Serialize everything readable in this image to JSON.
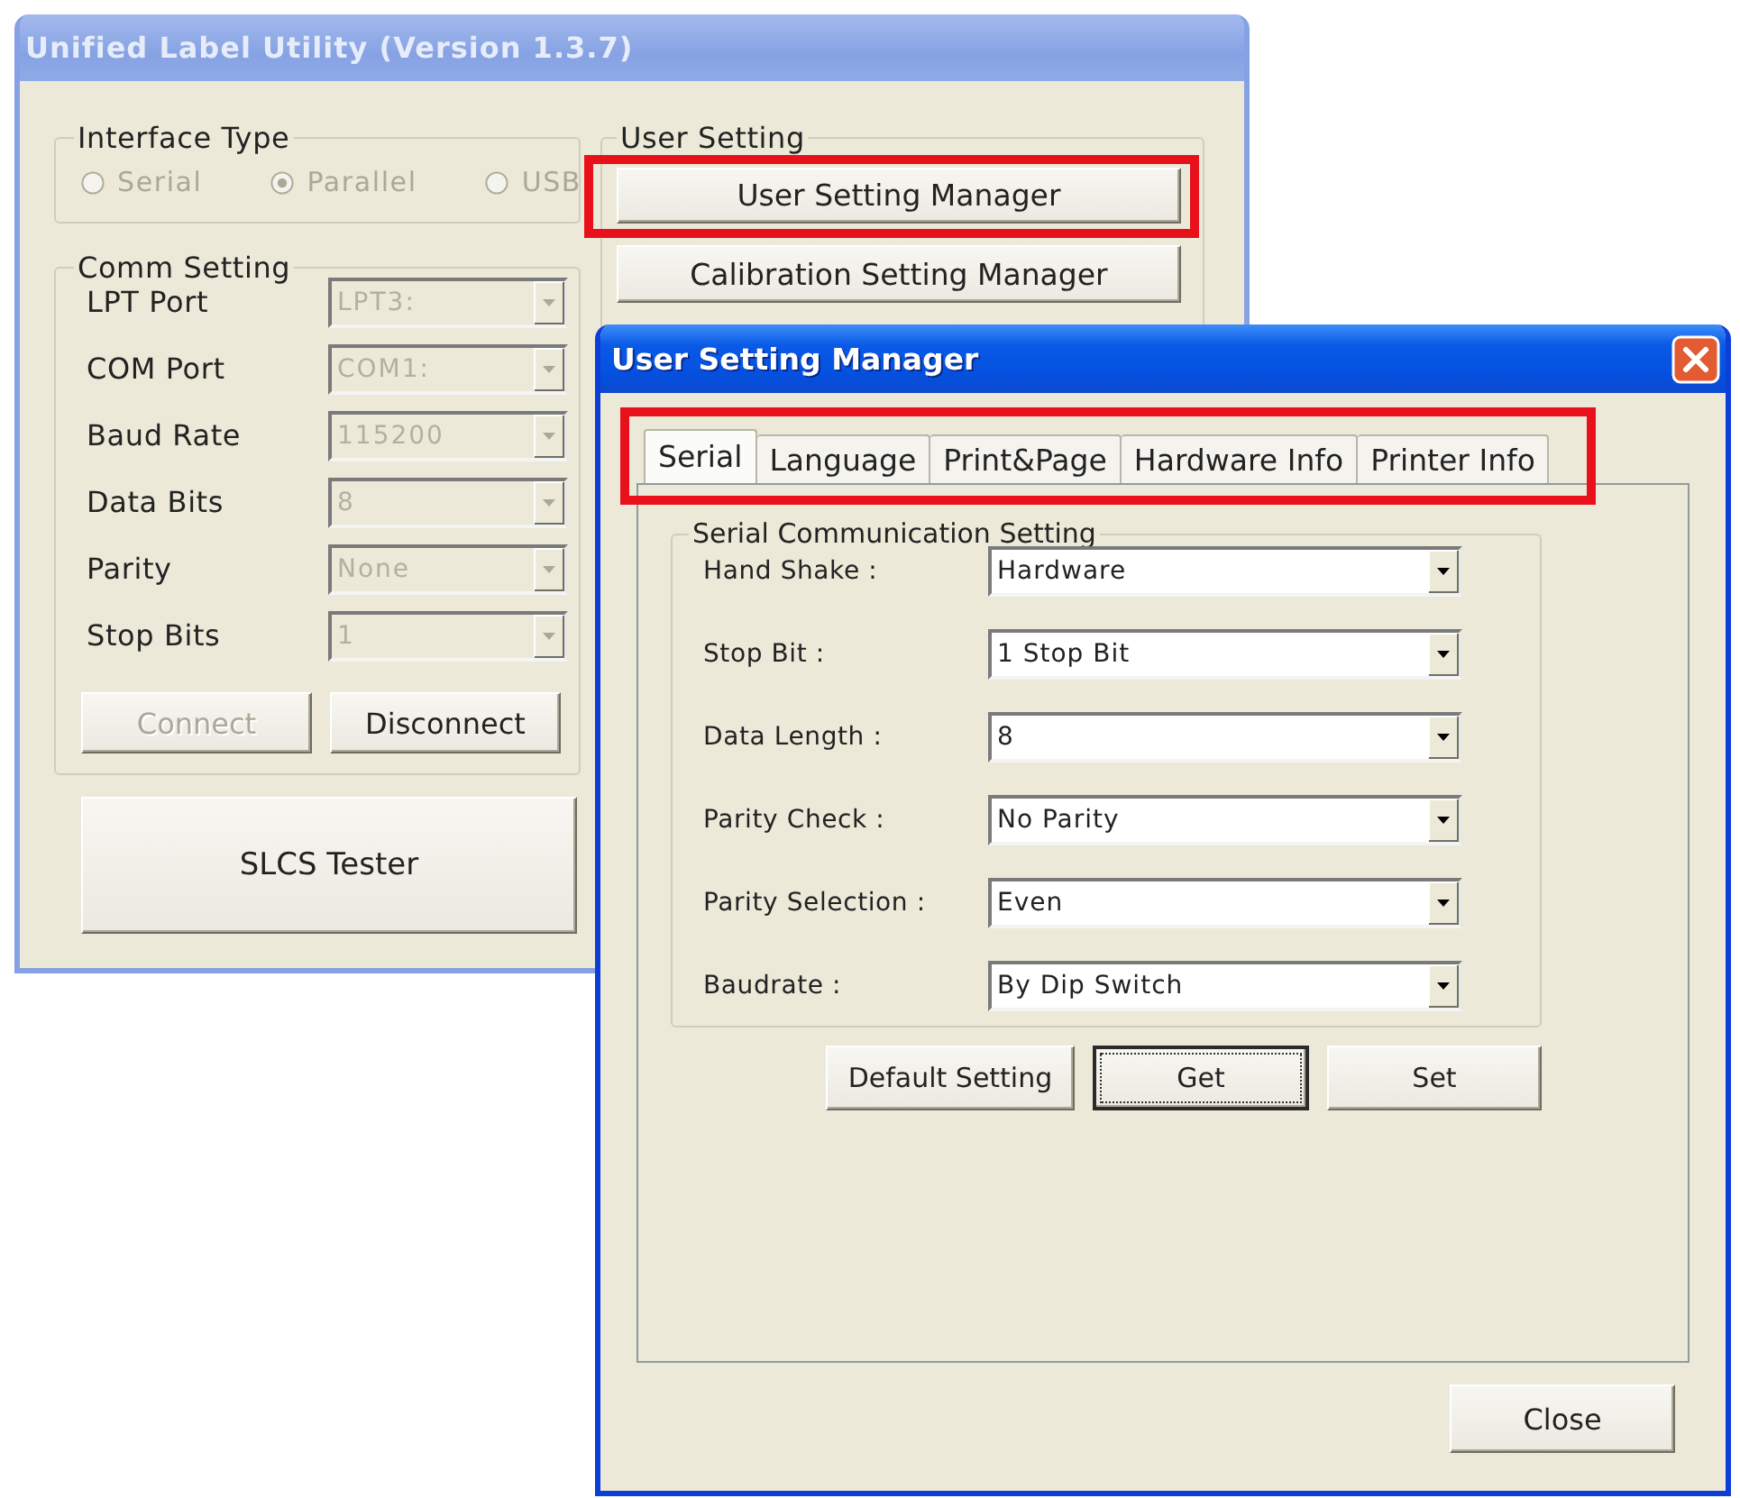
{
  "main_window": {
    "title": "Unified Label Utility (Version 1.3.7)",
    "active": false,
    "interface_type": {
      "legend": "Interface Type",
      "options": [
        {
          "label": "Serial",
          "selected": false,
          "disabled": true
        },
        {
          "label": "Parallel",
          "selected": true,
          "disabled": true
        },
        {
          "label": "USB",
          "selected": false,
          "disabled": true
        }
      ]
    },
    "comm_setting": {
      "legend": "Comm Setting",
      "fields": [
        {
          "label": "LPT Port",
          "value": "LPT3:",
          "disabled": true
        },
        {
          "label": "COM Port",
          "value": "COM1:",
          "disabled": true
        },
        {
          "label": "Baud Rate",
          "value": "115200",
          "disabled": true
        },
        {
          "label": "Data Bits",
          "value": "8",
          "disabled": true
        },
        {
          "label": "Parity",
          "value": "None",
          "disabled": true
        },
        {
          "label": "Stop Bits",
          "value": "1",
          "disabled": true
        }
      ],
      "buttons": [
        {
          "label": "Connect",
          "disabled": true
        },
        {
          "label": "Disconnect",
          "disabled": false
        }
      ]
    },
    "tester_button": {
      "label": "SLCS Tester"
    },
    "user_setting": {
      "legend": "User Setting",
      "buttons": [
        {
          "label": "User Setting Manager",
          "highlighted": true
        },
        {
          "label": "Calibration Setting Manager",
          "highlighted": false
        }
      ]
    }
  },
  "dialog": {
    "title": "User Setting Manager",
    "active": true,
    "tabs_highlighted": true,
    "tabs": [
      {
        "label": "Serial",
        "selected": true
      },
      {
        "label": "Language",
        "selected": false
      },
      {
        "label": "Print&Page",
        "selected": false
      },
      {
        "label": "Hardware Info",
        "selected": false
      },
      {
        "label": "Printer Info",
        "selected": false
      }
    ],
    "group": {
      "legend": "Serial Communication Setting",
      "fields": [
        {
          "label": "Hand Shake :",
          "value": "Hardware"
        },
        {
          "label": "Stop Bit :",
          "value": "1 Stop Bit"
        },
        {
          "label": "Data Length :",
          "value": "8"
        },
        {
          "label": "Parity Check :",
          "value": "No Parity"
        },
        {
          "label": "Parity Selection :",
          "value": "Even"
        },
        {
          "label": "Baudrate :",
          "value": "By Dip Switch"
        }
      ]
    },
    "buttons": [
      {
        "label": "Default Setting",
        "default": false
      },
      {
        "label": "Get",
        "default": true
      },
      {
        "label": "Set",
        "default": false
      }
    ],
    "close_button": {
      "label": "Close"
    }
  }
}
